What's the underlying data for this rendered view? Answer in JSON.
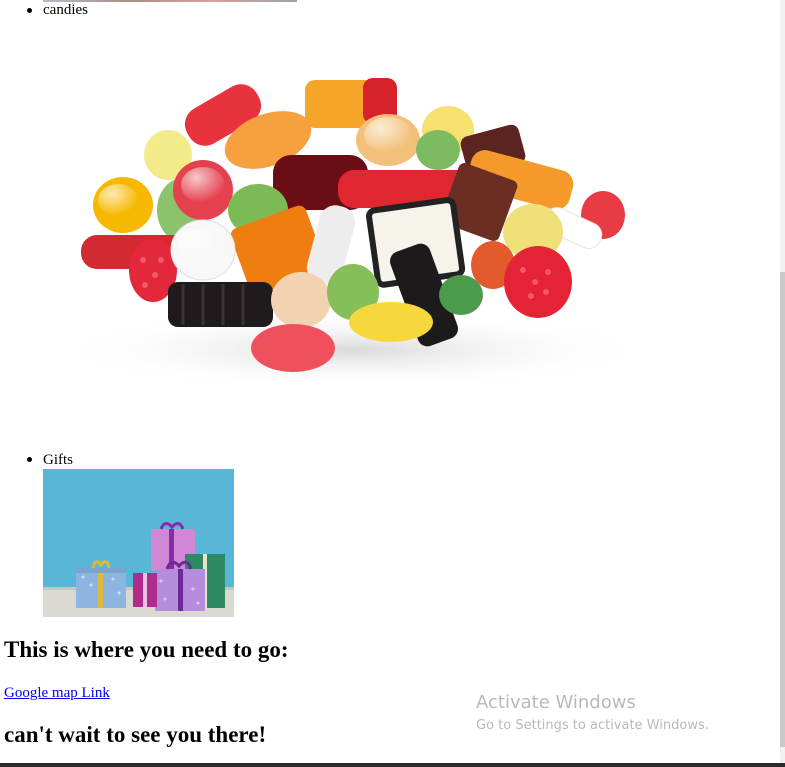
{
  "list": {
    "items": [
      {
        "label": "candies",
        "image_alt": "candy-assortment-image"
      },
      {
        "label": "Gifts",
        "image_alt": "gift-boxes-image"
      }
    ]
  },
  "location": {
    "heading": "This is where you need to go:",
    "link_text": "Google map Link"
  },
  "closing": {
    "heading": "can't wait to see you there!"
  },
  "watermark": {
    "title": "Activate Windows",
    "subtitle": "Go to Settings to activate Windows."
  },
  "colors": {
    "link": "#0000ee",
    "gift_background": "#5bb8d8",
    "watermark": "#b9b9b9"
  }
}
